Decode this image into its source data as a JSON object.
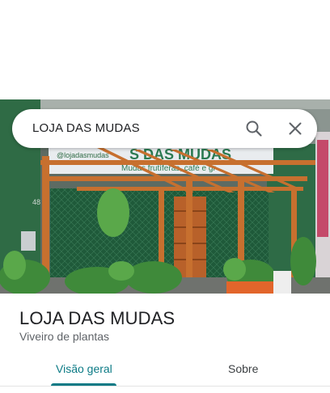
{
  "search": {
    "query": "LOJA DAS MUDAS",
    "search_icon": "search-icon",
    "close_icon": "close-icon"
  },
  "photo": {
    "sign_text": "S DAS MUDAS",
    "sign_subtext": "Mudas frutíferas, café e gr",
    "handle_text": "@lojadasmudas",
    "number_text": "48"
  },
  "place": {
    "title": "LOJA DAS MUDAS",
    "category": "Viveiro de plantas"
  },
  "tabs": [
    {
      "label": "Visão geral",
      "selected": true
    },
    {
      "label": "Sobre",
      "selected": false
    }
  ],
  "colors": {
    "accent": "#0b7a85",
    "title_text": "#202124",
    "secondary_text": "#5f6368"
  }
}
